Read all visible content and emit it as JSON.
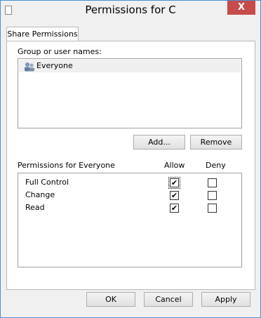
{
  "window": {
    "title": "Permissions for C",
    "close_label": "X"
  },
  "tabs": [
    {
      "label": "Share Permissions",
      "selected": true
    }
  ],
  "group_section": {
    "label": "Group or user names:",
    "users": [
      {
        "name": "Everyone",
        "icon": "users-icon",
        "selected": true
      }
    ]
  },
  "user_buttons": {
    "add": "Add...",
    "remove": "Remove"
  },
  "permissions": {
    "header": "Permissions for Everyone",
    "allow_header": "Allow",
    "deny_header": "Deny",
    "rows": [
      {
        "name": "Full Control",
        "allow": true,
        "deny": false
      },
      {
        "name": "Change",
        "allow": true,
        "deny": false
      },
      {
        "name": "Read",
        "allow": true,
        "deny": false
      }
    ]
  },
  "footer": {
    "ok": "OK",
    "cancel": "Cancel",
    "apply": "Apply"
  },
  "colors": {
    "close_button": "#c74b4b",
    "window_border": "#4a8fd0",
    "selection": "#f0f0f0"
  }
}
